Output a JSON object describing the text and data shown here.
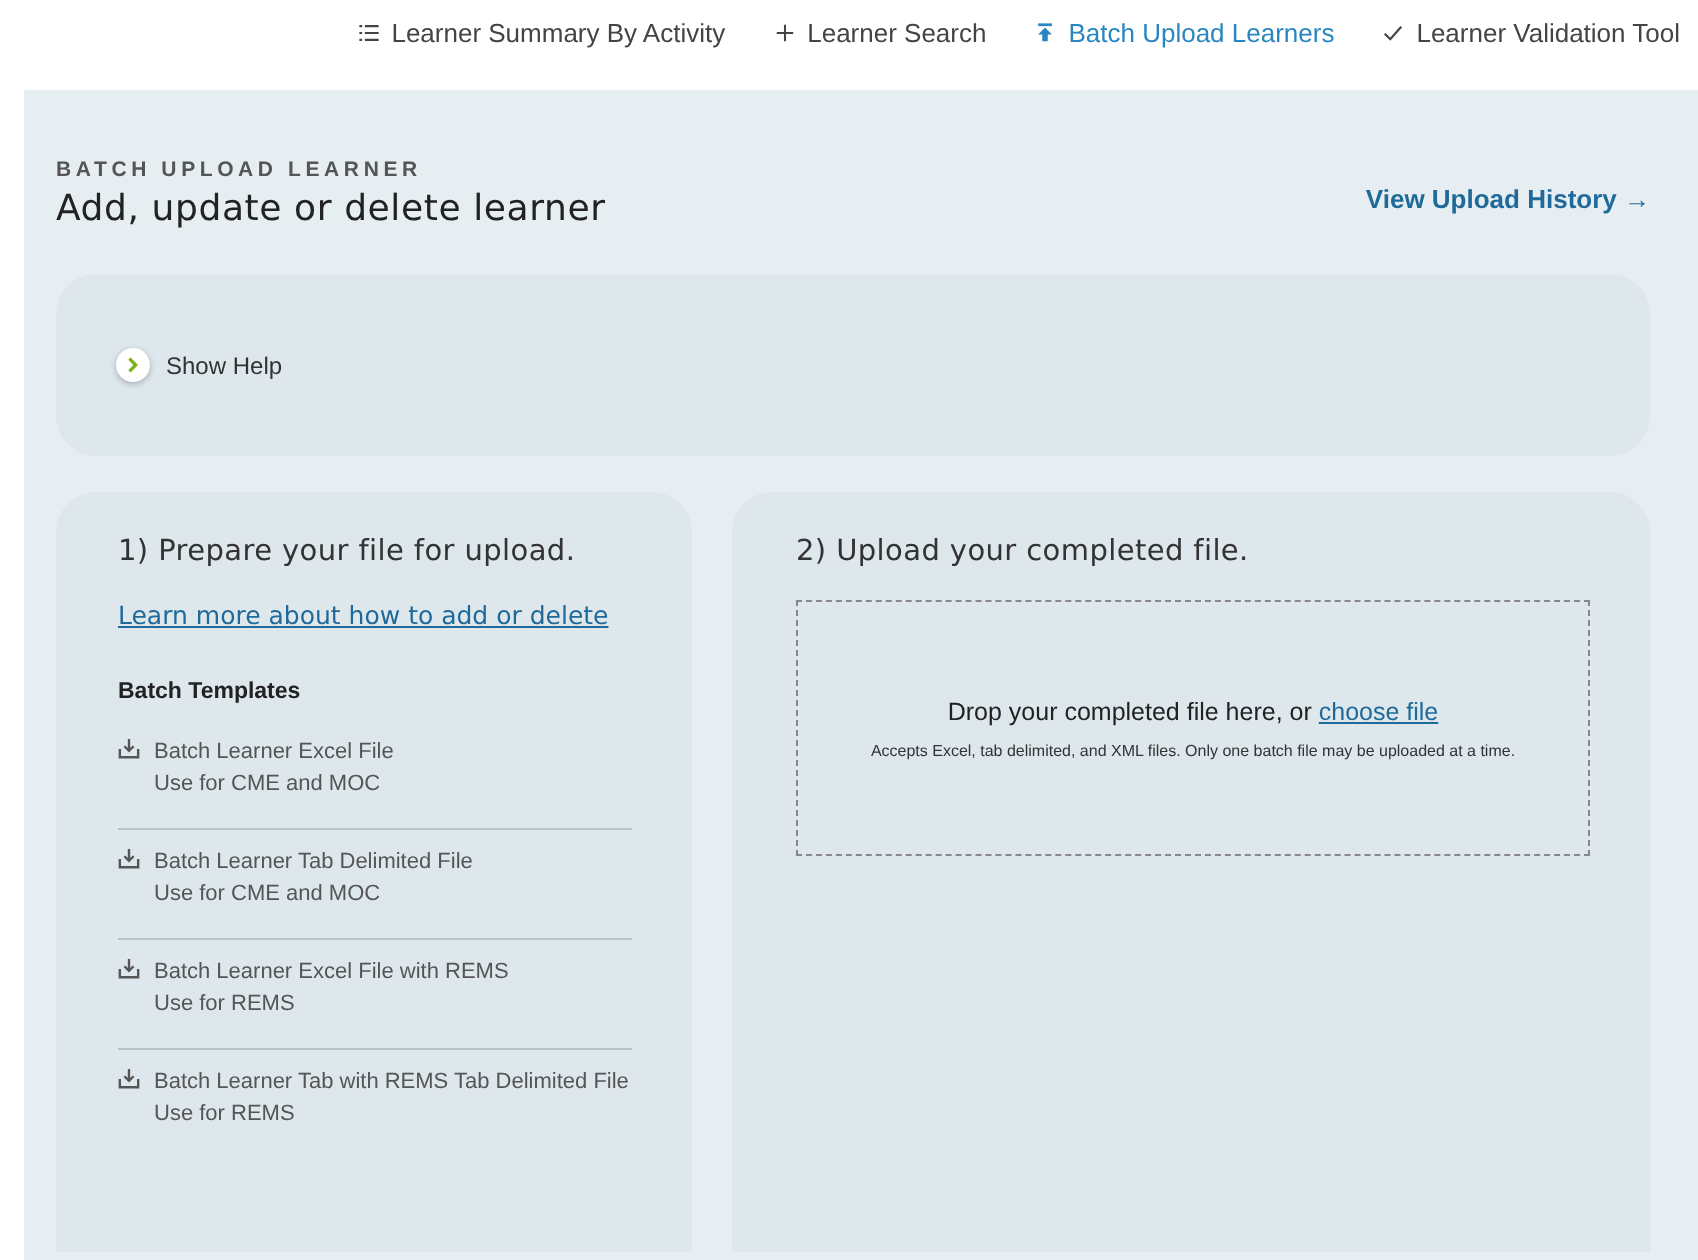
{
  "nav": [
    {
      "label": "Learner Summary By Activity",
      "kind": "list",
      "selected": false
    },
    {
      "label": "Learner Search",
      "kind": "plus",
      "selected": false
    },
    {
      "label": "Batch Upload Learners",
      "kind": "upload",
      "selected": true
    },
    {
      "label": "Learner Validation Tool",
      "kind": "check",
      "selected": false
    }
  ],
  "header": {
    "kicker": "BATCH UPLOAD LEARNER",
    "title": "Add, update or delete learner",
    "history_link": "View Upload History →"
  },
  "help": {
    "label": "Show Help",
    "expanded": false
  },
  "prepare": {
    "heading": "1) Prepare your file for upload.",
    "link": "Learn more about how to add or delete",
    "templates_heading": "Batch Templates",
    "templates": [
      {
        "name": "Batch Learner Excel File",
        "use": "Use for CME and MOC"
      },
      {
        "name": "Batch Learner Tab Delimited File",
        "use": "Use for CME and MOC"
      },
      {
        "name": "Batch Learner Excel File with REMS",
        "use": "Use for REMS"
      },
      {
        "name": "Batch Learner Tab with REMS Tab Delimited File",
        "use": "Use for REMS"
      }
    ]
  },
  "upload": {
    "heading": "2) Upload your completed file.",
    "drop_text": "Drop your completed file here, or",
    "choose_link": "choose file",
    "note": "Accepts Excel, tab delimited, and XML files. Only one batch file may be uploaded at a time."
  }
}
